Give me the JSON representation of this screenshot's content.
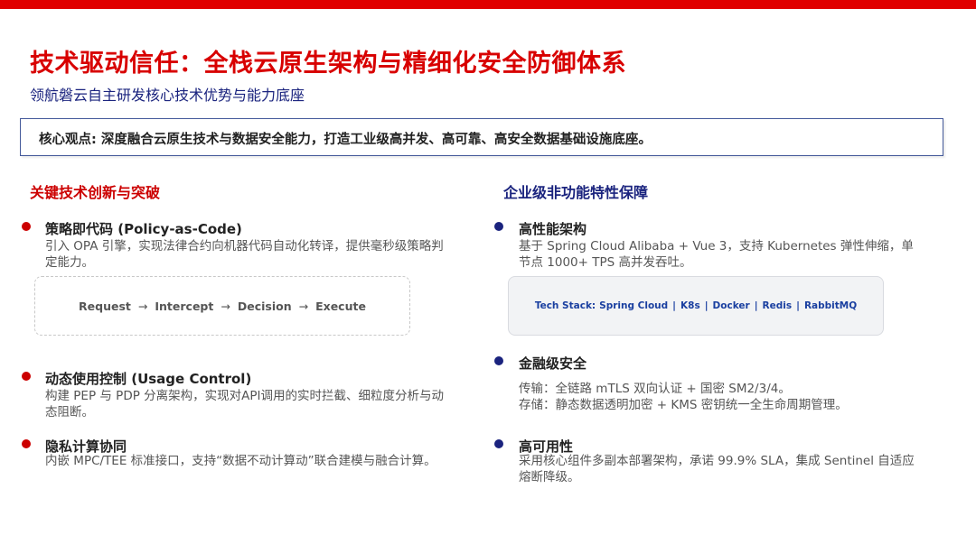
{
  "title": "技术驱动信任：全栈云原生架构与精细化安全防御体系",
  "subtitle": "领航磐云自主研发核心技术优势与能力底座",
  "core_view": "核心观点: 深度融合云原生技术与数据安全能力，打造工业级高并发、高可靠、高安全数据基础设施底座。",
  "left": {
    "heading": "关键技术创新与突破",
    "items": [
      {
        "title": "策略即代码 (Policy-as-Code)",
        "desc": "引入 OPA 引擎，实现法律合约向机器代码自动化转译，提供毫秒级策略判定能力。"
      },
      {
        "title": "动态使用控制 (Usage Control)",
        "desc": "构建 PEP 与 PDP 分离架构，实现对API调用的实时拦截、细粒度分析与动态阻断。"
      },
      {
        "title": "隐私计算协同",
        "desc": "内嵌 MPC/TEE 标准接口，支持“数据不动计算动”联合建模与融合计算。"
      }
    ],
    "flow": [
      "Request",
      "Intercept",
      "Decision",
      "Execute"
    ],
    "flow_arrow": "→"
  },
  "right": {
    "heading": "企业级非功能特性保障",
    "items": [
      {
        "title": "高性能架构",
        "desc": "基于 Spring Cloud Alibaba + Vue 3，支持 Kubernetes 弹性伸缩，单节点 1000+ TPS 高并发吞吐。"
      },
      {
        "title": "金融级安全",
        "desc_line1": "传输：全链路 mTLS 双向认证 + 国密 SM2/3/4。",
        "desc_line2": "存储：静态数据透明加密 + KMS 密钥统一全生命周期管理。"
      },
      {
        "title": "高可用性",
        "desc": "采用核心组件多副本部署架构，承诺 99.9% SLA，集成 Sentinel 自适应熔断降级。"
      }
    ],
    "stack_label": "Tech Stack:",
    "stack": [
      "Spring Cloud",
      "K8s",
      "Docker",
      "Redis",
      "RabbitMQ"
    ],
    "stack_sep": "|"
  },
  "colors": {
    "accent_red": "#cc0000",
    "navy": "#1a237e",
    "topbar": "#e00000"
  }
}
